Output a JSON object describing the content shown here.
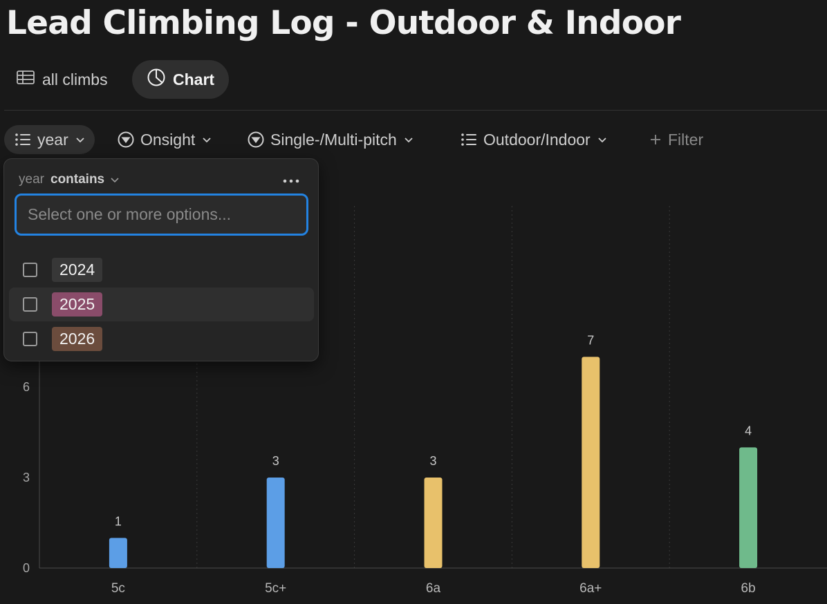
{
  "page": {
    "title": "Lead Climbing Log - Outdoor & Indoor"
  },
  "views": [
    {
      "label": "all climbs",
      "icon": "table-icon",
      "active": false
    },
    {
      "label": "Chart",
      "icon": "pie-chart-icon",
      "active": true
    }
  ],
  "filters": [
    {
      "label": "year",
      "icon": "list-icon",
      "selected": true
    },
    {
      "label": "Onsight",
      "icon": "circle-chevron-icon"
    },
    {
      "label": "Single-/Multi-pitch",
      "icon": "circle-chevron-icon"
    },
    {
      "label": "Outdoor/Indoor",
      "icon": "list-icon"
    },
    {
      "label": "Filter",
      "icon": "plus-icon"
    }
  ],
  "popup": {
    "property": "year",
    "operator": "contains",
    "more_icon": "more-horizontal-icon",
    "search_placeholder": "Select one or more options...",
    "search_value": "",
    "options": [
      {
        "label": "2024",
        "color": "#373737",
        "checked": false
      },
      {
        "label": "2025",
        "color": "#8a4c6a",
        "checked": false
      },
      {
        "label": "2026",
        "color": "#6b4c3d",
        "checked": false
      }
    ]
  },
  "colors": {
    "accent": "#2383e2",
    "background": "#191919"
  },
  "chart_data": {
    "type": "bar",
    "categories": [
      "5c",
      "5c+",
      "6a",
      "6a+",
      "6b"
    ],
    "values": [
      1,
      3,
      3,
      7,
      4
    ],
    "bar_colors": [
      "#5c9ee6",
      "#5c9ee6",
      "#e8c16b",
      "#e8c16b",
      "#6fba8b"
    ],
    "yticks": [
      0,
      3,
      6
    ],
    "ylim": [
      0,
      12
    ],
    "data_labels": true,
    "grid": "vertical dotted between categories"
  }
}
